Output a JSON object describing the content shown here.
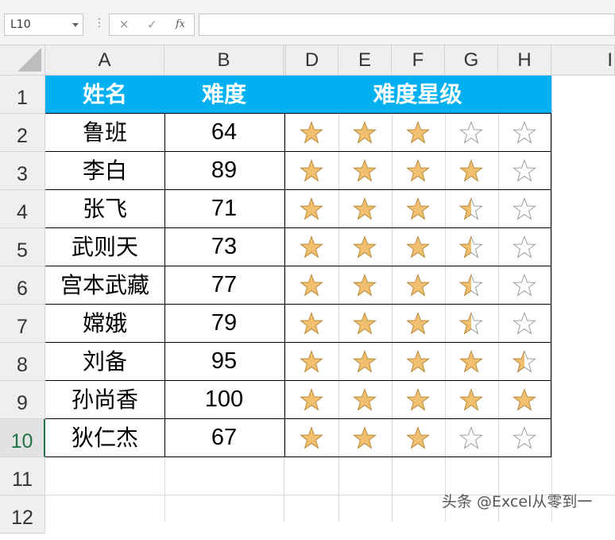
{
  "name_box": {
    "value": "L10"
  },
  "formula_bar": {
    "fx_label": "fx",
    "cancel_symbol": "✕",
    "enter_symbol": "✓",
    "value": ""
  },
  "columns": [
    "A",
    "B",
    "D",
    "E",
    "F",
    "G",
    "H",
    "I"
  ],
  "rows": [
    "1",
    "2",
    "3",
    "4",
    "5",
    "6",
    "7",
    "8",
    "9",
    "10",
    "11",
    "12"
  ],
  "active_row": "10",
  "header": {
    "name": "姓名",
    "difficulty": "难度",
    "rating": "难度星级"
  },
  "table": [
    {
      "name": "鲁班",
      "score": "64",
      "stars": [
        1,
        1,
        1,
        0,
        0
      ]
    },
    {
      "name": "李白",
      "score": "89",
      "stars": [
        1,
        1,
        1,
        1,
        0
      ]
    },
    {
      "name": "张飞",
      "score": "71",
      "stars": [
        1,
        1,
        1,
        0.5,
        0
      ]
    },
    {
      "name": "武则天",
      "score": "73",
      "stars": [
        1,
        1,
        1,
        0.5,
        0
      ]
    },
    {
      "name": "宫本武藏",
      "score": "77",
      "stars": [
        1,
        1,
        1,
        0.5,
        0
      ]
    },
    {
      "name": "嫦娥",
      "score": "79",
      "stars": [
        1,
        1,
        1,
        0.5,
        0
      ]
    },
    {
      "name": "刘备",
      "score": "95",
      "stars": [
        1,
        1,
        1,
        1,
        0.5
      ]
    },
    {
      "name": "孙尚香",
      "score": "100",
      "stars": [
        1,
        1,
        1,
        1,
        1
      ]
    },
    {
      "name": "狄仁杰",
      "score": "67",
      "stars": [
        1,
        1,
        1,
        0,
        0
      ]
    }
  ],
  "colors": {
    "header_fill": "#00b0f0",
    "star_fill": "#f0c070",
    "star_stroke": "#b8893a",
    "empty_star_stroke": "#9a9a9a"
  },
  "watermark": "头条 @Excel从零到一"
}
